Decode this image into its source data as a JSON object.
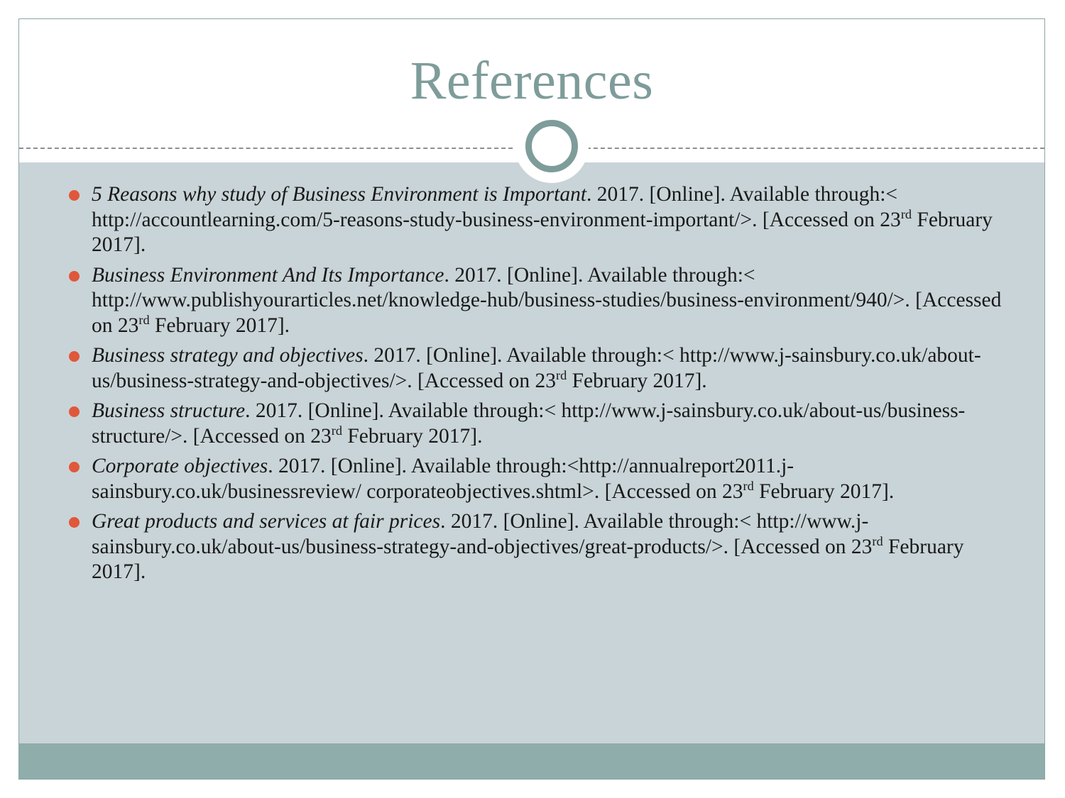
{
  "slide": {
    "title": "References",
    "colors": {
      "title_text": "#7e9c9a",
      "body_background": "#c9d4d8",
      "footer_band": "#8fadab",
      "slide_border": "#8ba7a4",
      "bullet_marker": "#e0573a",
      "body_text": "#191919",
      "divider": "#8a8f90"
    }
  },
  "references": [
    {
      "title": "5 Reasons why study of Business Environment is Important",
      "year": ". 2017. [Online]. Available through:< http://accountlearning.com/5-reasons-study-business-environment-important/>. [Accessed on 23",
      "ordinal": "rd",
      "tail": " February 2017]."
    },
    {
      "title": "Business Environment And Its Importance",
      "year": ". 2017. [Online]. Available through:< http://www.publishyourarticles.net/knowledge-hub/business-studies/business-environment/940/>. [Accessed on 23",
      "ordinal": "rd",
      "tail": " February 2017]."
    },
    {
      "title": "Business strategy and objectives",
      "year": ". 2017. [Online]. Available through:< http://www.j-sainsbury.co.uk/about-us/business-strategy-and-objectives/>. [Accessed on 23",
      "ordinal": "rd",
      "tail": " February 2017]."
    },
    {
      "title": "Business structure",
      "year": ". 2017. [Online]. Available through:< http://www.j-sainsbury.co.uk/about-us/business-structure/>. [Accessed on 23",
      "ordinal": "rd",
      "tail": " February 2017]."
    },
    {
      "title": "Corporate objectives",
      "year": ". 2017. [Online]. Available through:<http://annualreport2011.j-sainsbury.co.uk/businessreview/ corporateobjectives.shtml>. [Accessed on 23",
      "ordinal": "rd",
      "tail": " February 2017]."
    },
    {
      "title": "Great products and services at fair prices",
      "year": ". 2017. [Online]. Available through:< http://www.j-sainsbury.co.uk/about-us/business-strategy-and-objectives/great-products/>. [Accessed on 23",
      "ordinal": "rd",
      "tail": " February 2017]."
    }
  ]
}
